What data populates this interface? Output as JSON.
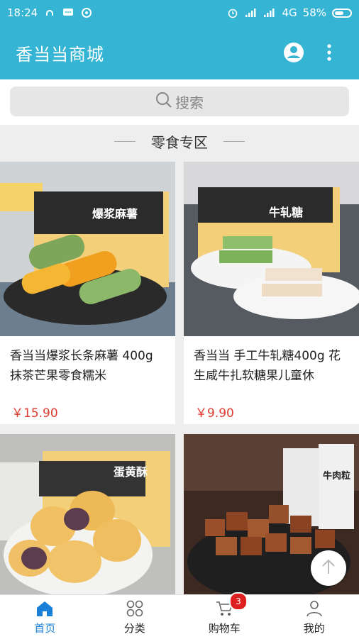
{
  "status_bar": {
    "time": "18:24",
    "signal_label": "4G",
    "battery_percent": "58%",
    "battery_level": 0.58
  },
  "app_bar": {
    "title": "香当当商城"
  },
  "search": {
    "placeholder": "搜索"
  },
  "section": {
    "title": "零食专区"
  },
  "products": [
    {
      "title": "香当当爆浆长条麻薯 400g 抹茶芒果零食糯米",
      "price": "￥15.90",
      "package_label": "爆浆麻薯"
    },
    {
      "title": "香当当 手工牛轧糖400g 花生咸牛扎软糖果儿童休",
      "price": "￥9.90",
      "package_label": "牛轧糖"
    },
    {
      "title": "",
      "price": "",
      "package_label": "蛋黄酥"
    },
    {
      "title": "",
      "price": "",
      "package_label": "牛肉粒"
    }
  ],
  "tabs": [
    {
      "label": "首页",
      "icon": "home-icon"
    },
    {
      "label": "分类",
      "icon": "category-icon"
    },
    {
      "label": "购物车",
      "icon": "cart-icon",
      "badge": "3"
    },
    {
      "label": "我的",
      "icon": "profile-icon"
    }
  ],
  "colors": {
    "primary": "#35b4d4",
    "price": "#e03a2f",
    "active_tab": "#1a7fd6",
    "badge": "#e02020"
  }
}
